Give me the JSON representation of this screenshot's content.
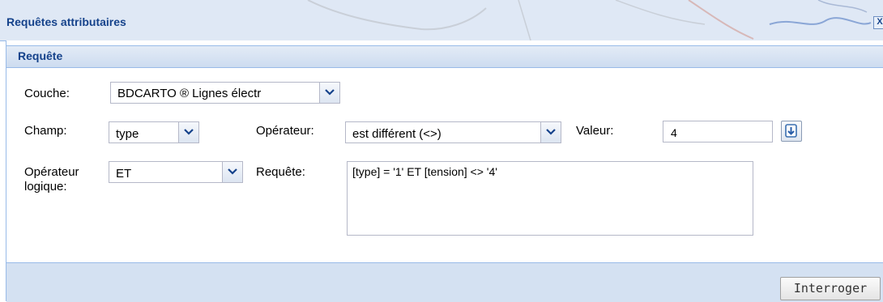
{
  "window": {
    "title": "Requêtes attributaires",
    "close_label": "X"
  },
  "panel": {
    "title": "Requête"
  },
  "form": {
    "couche": {
      "label": "Couche:",
      "value": "BDCARTO ® Lignes électr"
    },
    "champ": {
      "label": "Champ:",
      "value": "type"
    },
    "operateur": {
      "label": "Opérateur:",
      "value": "est différent (<>)"
    },
    "valeur": {
      "label": "Valeur:",
      "value": "4"
    },
    "operateur_logique": {
      "label_line1": "Opérateur",
      "label_line2": "logique:",
      "value": "ET"
    },
    "requete": {
      "label": "Requête:",
      "value": "[type] = '1' ET [tension] <> '4'"
    }
  },
  "buttons": {
    "interroger": "Interroger"
  },
  "colors": {
    "title_text": "#15428b",
    "border": "#99bbe8",
    "footer_bg": "#d4e1f2"
  },
  "icons": [
    "close-icon",
    "chevron-down-icon",
    "add-down-arrow-icon"
  ]
}
